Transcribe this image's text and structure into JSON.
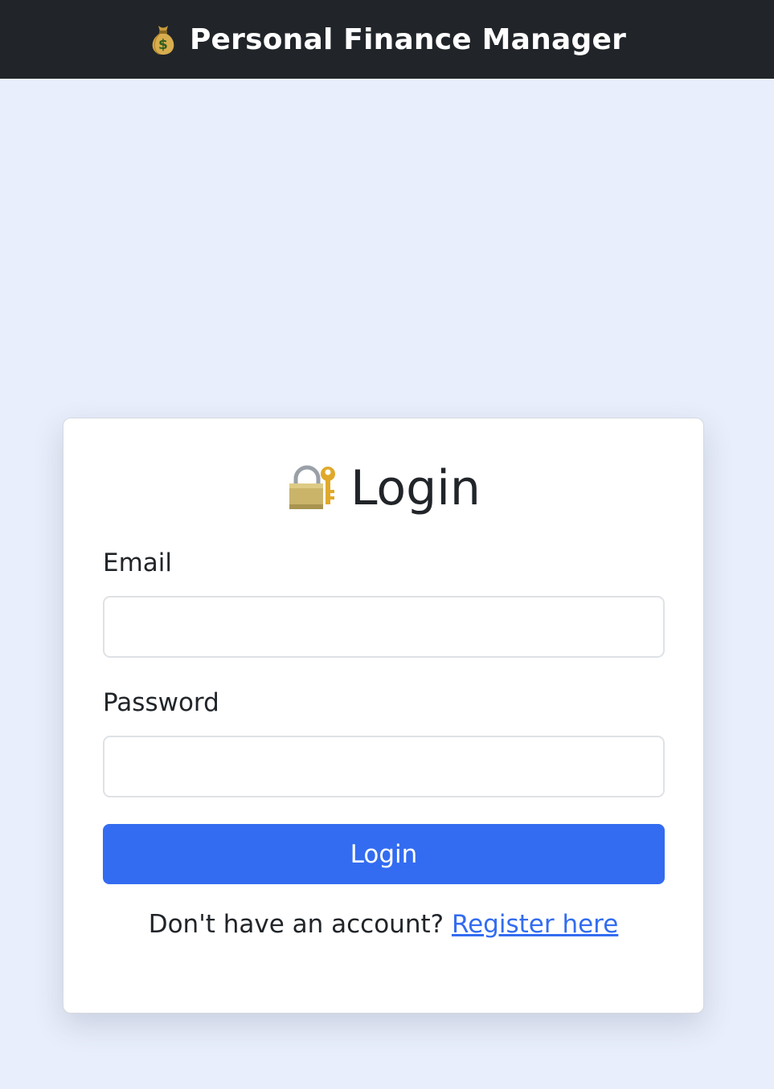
{
  "navbar": {
    "brand_icon": "money-bag-icon",
    "brand_title": "Personal Finance Manager",
    "background": "#212529"
  },
  "login_card": {
    "title_icon": "lock-with-key-icon",
    "title": "Login",
    "email_label": "Email",
    "email_value": "",
    "password_label": "Password",
    "password_value": "",
    "submit_label": "Login",
    "footer_prompt": "Don't have an account?",
    "register_link": "Register here"
  },
  "colors": {
    "page_background": "#e8eefb",
    "accent": "#336cf0",
    "text": "#212529"
  }
}
